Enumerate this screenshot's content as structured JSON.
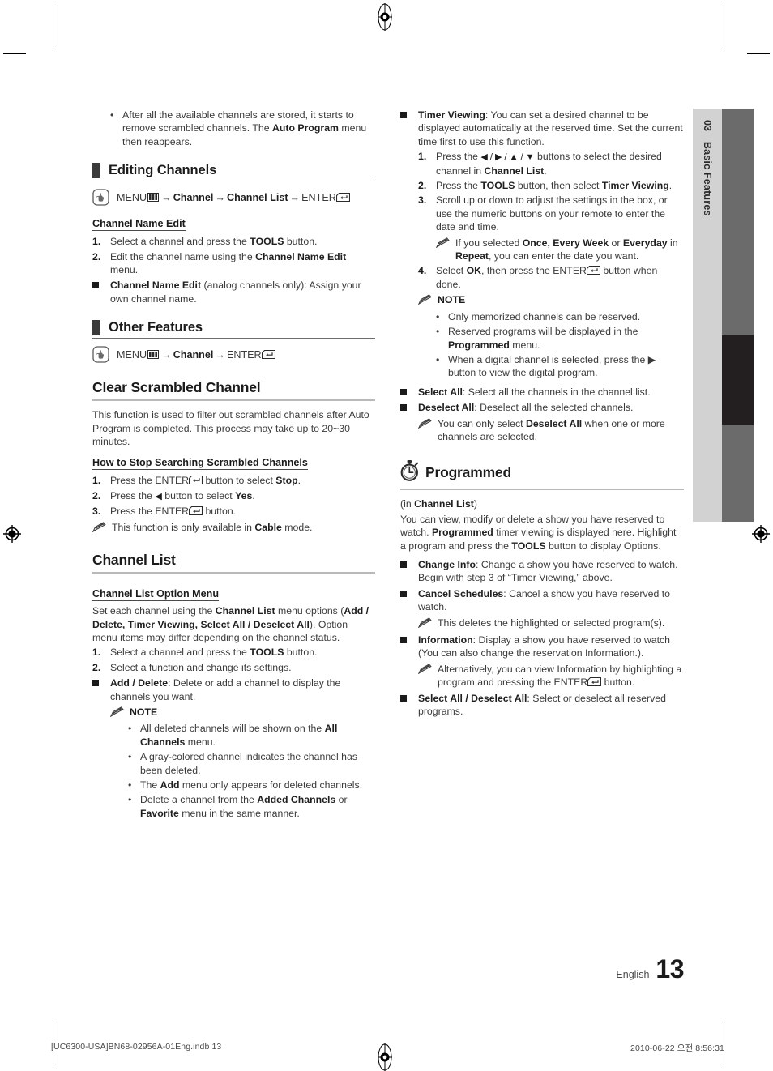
{
  "page": {
    "number": "13",
    "language": "English",
    "footer_left": "[UC6300-USA]BN68-02956A-01Eng.indb   13",
    "footer_right": "2010-06-22   오전 8:56:31"
  },
  "side_tab": {
    "number": "03",
    "label": "Basic Features",
    "colors": {
      "light": "#d2d2d2",
      "dark": "#6b6b6b",
      "active": "#231f20"
    }
  },
  "left_column": {
    "top_bullet": {
      "marker": "•",
      "text_1": "After all the available channels are stored, it starts to remove scrambled channels. The ",
      "bold_1": "Auto Program",
      "text_2": " menu then reappears."
    },
    "editing_channels": {
      "heading": "Editing Channels",
      "menu_path": {
        "icon": "hand-press-icon",
        "menu_label": "MENU",
        "menu_glyph": "menu-grid-icon",
        "arrow_1": "→",
        "item_1": "Channel",
        "arrow_2": "→",
        "item_2": "Channel List",
        "arrow_3": "→",
        "enter_label": "ENTER",
        "enter_glyph": "enter-key-icon"
      },
      "subhead": "Channel Name Edit",
      "steps": [
        {
          "n": "1.",
          "text_1": "Select a channel and press the ",
          "bold_1": "TOOLS",
          "text_2": " button."
        },
        {
          "n": "2.",
          "text_1": "Edit the channel name using the ",
          "bold_1": "Channel Name Edit",
          "text_2": " menu."
        }
      ],
      "square_item": {
        "bold_1": "Channel Name Edit",
        "text_1": " (analog channels only): Assign your own channel name."
      }
    },
    "other_features": {
      "heading": "Other Features",
      "menu_path": {
        "icon": "hand-press-icon",
        "menu_label": "MENU",
        "menu_glyph": "menu-grid-icon",
        "arrow_1": "→",
        "item_1": "Channel",
        "arrow_2": "→",
        "enter_label": "ENTER",
        "enter_glyph": "enter-key-icon"
      }
    },
    "clear_scrambled": {
      "title": "Clear Scrambled Channel",
      "body": "This function is used to filter out scrambled channels after Auto Program is completed. This process may take up to 20~30 minutes.",
      "subhead": "How to Stop Searching Scrambled Channels",
      "steps": [
        {
          "n": "1.",
          "text_1": "Press the ENTER",
          "glyph": "enter-key-icon",
          "text_2": " button to select ",
          "bold_1": "Stop",
          "text_3": "."
        },
        {
          "n": "2.",
          "text_1": "Press the ",
          "glyph": "arrow-left-icon",
          "text_2": " button to select ",
          "bold_1": "Yes",
          "text_3": "."
        },
        {
          "n": "3.",
          "text_1": "Press the ENTER",
          "glyph": "enter-key-icon",
          "text_2": " button.",
          "bold_1": "",
          "text_3": ""
        }
      ],
      "note": {
        "text_1": "This function is only available in ",
        "bold_1": "Cable",
        "text_2": " mode."
      }
    },
    "channel_list": {
      "title": "Channel List",
      "subhead": "Channel List Option Menu",
      "intro_1": "Set each channel using the ",
      "intro_bold_1": "Channel List",
      "intro_2": " menu options (",
      "intro_bold_2": "Add / Delete, Timer Viewing, Select All / Deselect All",
      "intro_3": "). Option menu items may differ depending on the channel status.",
      "steps": [
        {
          "n": "1.",
          "text_1": "Select a channel and press the ",
          "bold_1": "TOOLS",
          "text_2": " button."
        },
        {
          "n": "2.",
          "text_1": "Select a function and change its settings.",
          "bold_1": "",
          "text_2": ""
        }
      ],
      "add_delete": {
        "bold_1": "Add / Delete",
        "text_1": ": Delete or add a channel to display the channels you want."
      },
      "note_head": "NOTE",
      "notes": [
        {
          "text_1": "All deleted channels will be shown on the ",
          "bold_1": "All Channels",
          "text_2": " menu."
        },
        {
          "text_1": "A gray-colored channel indicates the channel has been deleted.",
          "bold_1": "",
          "text_2": ""
        },
        {
          "text_1": "The ",
          "bold_1": "Add",
          "text_2": " menu only appears for deleted channels."
        },
        {
          "text_1": "Delete a channel from the ",
          "bold_1": "Added Channels",
          "text_2": " or ",
          "bold_2": "Favorite",
          "text_3": " menu in the same manner."
        }
      ]
    }
  },
  "right_column": {
    "timer_viewing": {
      "bold_1": "Timer Viewing",
      "text_1": ": You can set a desired channel to be displayed automatically at the reserved time. Set the current time first to use this function.",
      "steps": [
        {
          "n": "1.",
          "text_1": "Press the ",
          "arrows": "◀ / ▶ / ▲ / ▼",
          "text_2": " buttons to select the desired channel in ",
          "bold_1": "Channel List",
          "text_3": "."
        },
        {
          "n": "2.",
          "text_1": "Press the ",
          "bold_1": "TOOLS",
          "text_2": " button, then select ",
          "bold_2": "Timer Viewing",
          "text_3": "."
        },
        {
          "n": "3.",
          "text_1": "Scroll up or down to adjust the settings in the box, or use the numeric buttons on your remote to enter the date and time.",
          "bold_1": "",
          "text_2": ""
        }
      ],
      "inner_note": {
        "text_1": "If you selected ",
        "bold_1": "Once, Every Week",
        "text_2": " or ",
        "bold_2": "Everyday",
        "text_3": " in ",
        "bold_3": "Repeat",
        "text_4": ", you can enter the date you want."
      },
      "step4": {
        "n": "4.",
        "text_1": "Select ",
        "bold_1": "OK",
        "text_2": ", then press the ENTER",
        "glyph": "enter-key-icon",
        "text_3": " button when done."
      },
      "note_head": "NOTE",
      "notes": [
        {
          "text_1": "Only memorized channels can be reserved.",
          "bold_1": "",
          "text_2": ""
        },
        {
          "text_1": "Reserved programs will be displayed in the ",
          "bold_1": "Programmed",
          "text_2": " menu."
        },
        {
          "text_1": "When a digital channel is selected, press the ▶ button to view the digital program.",
          "bold_1": "",
          "text_2": ""
        }
      ]
    },
    "select_all": {
      "bold_1": "Select All",
      "text_1": ": Select all the channels in the channel list."
    },
    "deselect_all": {
      "bold_1": "Deselect All",
      "text_1": ": Deselect all the selected channels."
    },
    "deselect_note": {
      "text_1": "You can only select ",
      "bold_1": "Deselect All",
      "text_2": " when one or more channels are selected."
    },
    "programmed": {
      "icon": "stopwatch-icon",
      "title": "Programmed",
      "sub_1": "(in ",
      "sub_bold": "Channel List",
      "sub_2": ")",
      "body_1": "You can view, modify or delete a show you have reserved to watch. ",
      "body_bold_1": "Programmed",
      "body_2": " timer viewing is displayed here. Highlight a program and press the ",
      "body_bold_2": "TOOLS",
      "body_3": " button to display Options.",
      "items": [
        {
          "bold_1": "Change Info",
          "text_1": ": Change a show you have reserved to watch. Begin with step 3 of “Timer Viewing,” above."
        },
        {
          "bold_1": "Cancel Schedules",
          "text_1": ": Cancel a show you have reserved to watch."
        }
      ],
      "cancel_note": {
        "text_1": "This deletes the highlighted or selected program(s).",
        "bold_1": "",
        "text_2": ""
      },
      "information": {
        "bold_1": "Information",
        "text_1": ": Display a show you have reserved to watch (You can also change the reservation Information.)."
      },
      "information_note": {
        "text_1": "Alternatively, you can view Information by highlighting a program and pressing the ENTER",
        "glyph": "enter-key-icon",
        "text_2": " button."
      },
      "select_deselect": {
        "bold_1": "Select All / Deselect All",
        "text_1": ": Select or deselect all reserved programs."
      }
    }
  }
}
